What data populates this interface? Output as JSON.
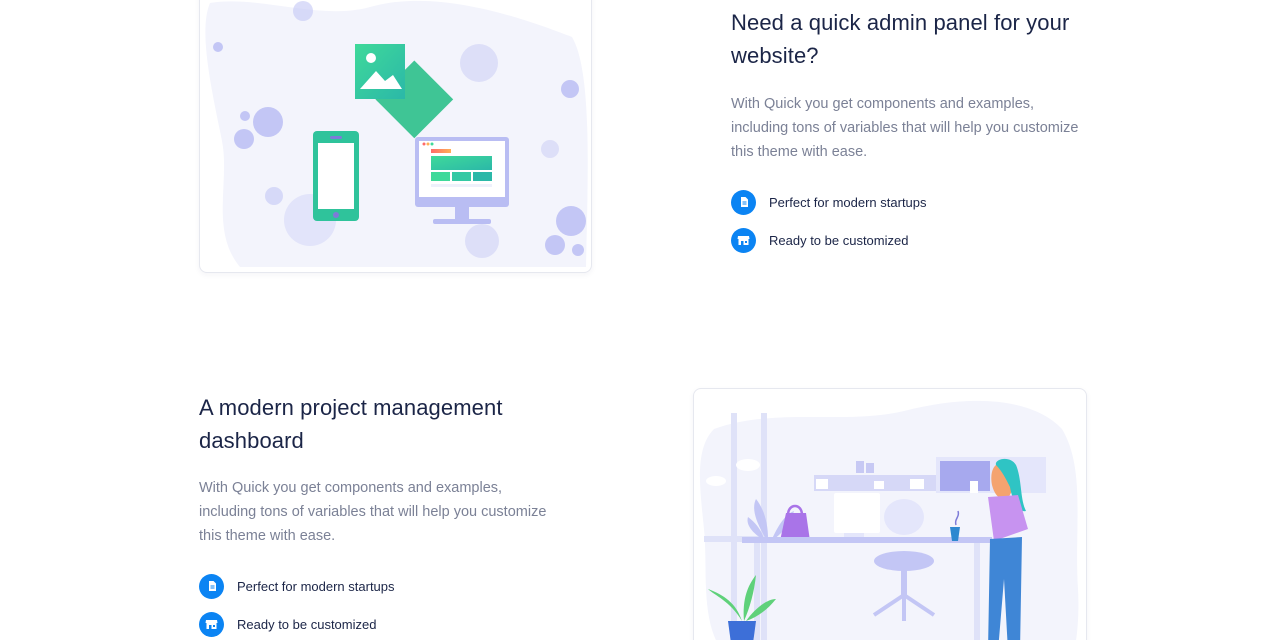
{
  "section1": {
    "heading": "Need a quick admin panel for your website?",
    "paragraph": "With Quick you get components and examples, including tons of variables that will help you customize this theme with ease.",
    "features": [
      {
        "label": "Perfect for modern startups",
        "icon": "document-icon"
      },
      {
        "label": "Ready to be customized",
        "icon": "store-icon"
      }
    ]
  },
  "section2": {
    "heading": "A modern project management dashboard",
    "paragraph": "With Quick you get components and examples, including tons of variables that will help you customize this theme with ease.",
    "features": [
      {
        "label": "Perfect for modern startups",
        "icon": "document-icon"
      },
      {
        "label": "Ready to be customized",
        "icon": "store-icon"
      }
    ]
  },
  "colors": {
    "accent": "#0b84f3",
    "heading": "#1b2547",
    "body_text": "#7b8196",
    "illustration_blob": "#f3f4fc",
    "illustration_bubble": "#c3c6f5"
  }
}
